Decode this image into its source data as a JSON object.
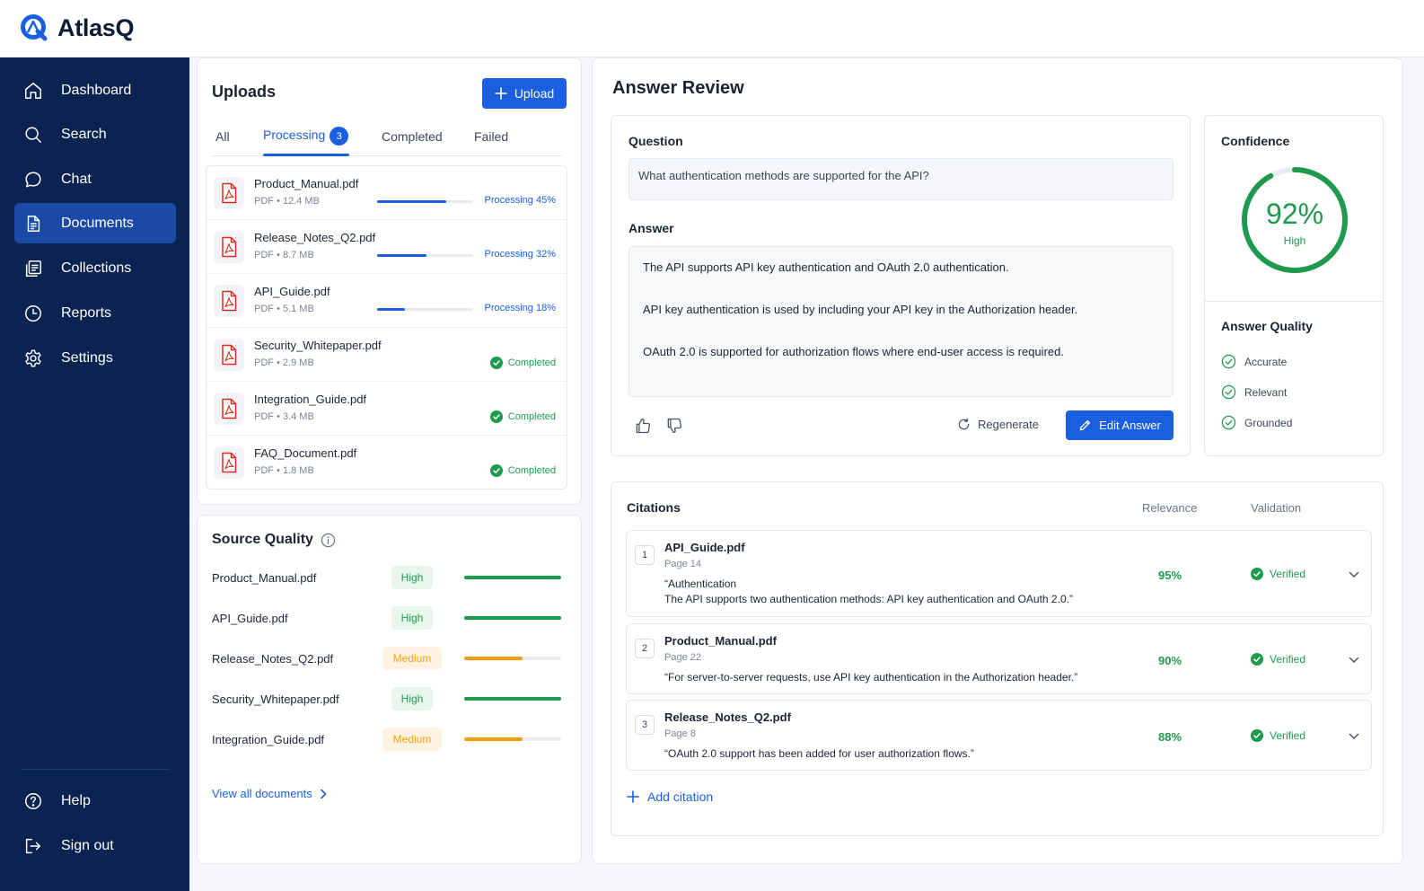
{
  "brand": {
    "name": "AtlasQ"
  },
  "sidebar": {
    "items": [
      {
        "label": "Dashboard",
        "icon": "home-icon"
      },
      {
        "label": "Search",
        "icon": "search-icon"
      },
      {
        "label": "Chat",
        "icon": "chat-icon"
      },
      {
        "label": "Documents",
        "icon": "document-icon",
        "active": true
      },
      {
        "label": "Collections",
        "icon": "collections-icon"
      },
      {
        "label": "Reports",
        "icon": "clock-icon"
      },
      {
        "label": "Settings",
        "icon": "gear-icon"
      }
    ],
    "bottom": [
      {
        "label": "Help",
        "icon": "help-icon"
      },
      {
        "label": "Sign out",
        "icon": "sign-out-icon"
      }
    ]
  },
  "uploads": {
    "title": "Uploads",
    "upload_label": "Upload",
    "tabs": [
      {
        "label": "All"
      },
      {
        "label": "Processing",
        "badge": "3",
        "active": true
      },
      {
        "label": "Completed"
      },
      {
        "label": "Failed"
      }
    ],
    "files": [
      {
        "name": "Product_Manual.pdf",
        "meta": "PDF  •  12.4 MB",
        "status": "Processing 45%",
        "progress": 0.45
      },
      {
        "name": "Release_Notes_Q2.pdf",
        "meta": "PDF  •  8.7 MB",
        "status": "Processing 32%",
        "progress": 0.32
      },
      {
        "name": "API_Guide.pdf",
        "meta": "PDF  •  5.1 MB",
        "status": "Processing 18%",
        "progress": 0.18
      },
      {
        "name": "Security_Whitepaper.pdf",
        "meta": "PDF  •  2.9 MB",
        "status": "Completed"
      },
      {
        "name": "Integration_Guide.pdf",
        "meta": "PDF  •  3.4 MB",
        "status": "Completed"
      },
      {
        "name": "FAQ_Document.pdf",
        "meta": "PDF  •  1.8 MB",
        "status": "Completed"
      }
    ]
  },
  "source_quality": {
    "title": "Source Quality",
    "items": [
      {
        "name": "Product_Manual.pdf",
        "level": "High",
        "score": 1.0
      },
      {
        "name": "API_Guide.pdf",
        "level": "High",
        "score": 1.0
      },
      {
        "name": "Release_Notes_Q2.pdf",
        "level": "Medium",
        "score": 0.6
      },
      {
        "name": "Security_Whitepaper.pdf",
        "level": "High",
        "score": 1.0
      },
      {
        "name": "Integration_Guide.pdf",
        "level": "Medium",
        "score": 0.6
      }
    ],
    "view_all": "View all documents"
  },
  "answer_review": {
    "title": "Answer Review",
    "question_label": "Question",
    "question": "What authentication methods are supported for the API?",
    "answer_label": "Answer",
    "answer": [
      "The API supports API key authentication and OAuth 2.0 authentication.",
      "API key authentication is used by including your API key in the Authorization header.",
      "OAuth 2.0 is supported for authorization flows where end-user access is required."
    ],
    "regenerate_label": "Regenerate",
    "edit_label": "Edit Answer"
  },
  "confidence": {
    "title": "Confidence",
    "value_text": "92%",
    "value": 0.92,
    "level": "High",
    "quality_title": "Answer Quality",
    "quality_items": [
      "Accurate",
      "Relevant",
      "Grounded"
    ]
  },
  "citations": {
    "title": "Citations",
    "relevance_header": "Relevance",
    "validation_header": "Validation",
    "items": [
      {
        "num": "1",
        "file": "API_Guide.pdf",
        "page": "Page 14",
        "quote": [
          "“Authentication",
          "The API supports two authentication methods: API key authentication and OAuth 2.0.”"
        ],
        "relevance": "95%",
        "validation": "Verified"
      },
      {
        "num": "2",
        "file": "Product_Manual.pdf",
        "page": "Page 22",
        "quote": [
          "“For server-to-server requests, use API key authentication in the Authorization header.”"
        ],
        "relevance": "90%",
        "validation": "Verified"
      },
      {
        "num": "3",
        "file": "Release_Notes_Q2.pdf",
        "page": "Page 8",
        "quote": [
          "“OAuth 2.0 support has been added for user authorization flows.”"
        ],
        "relevance": "88%",
        "validation": "Verified"
      }
    ],
    "add_label": "Add citation"
  },
  "colors": {
    "accent": "#1a5fe0",
    "sidebar": "#0b2350",
    "success": "#1e9a4e",
    "warning": "#f59e0b"
  }
}
